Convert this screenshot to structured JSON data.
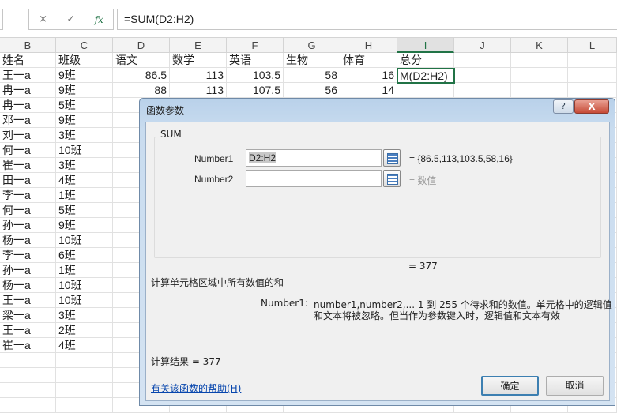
{
  "formula_bar": {
    "cancel_icon": "×",
    "enter_icon": "✓",
    "fx_label": "fx",
    "formula": "=SUM(D2:H2)"
  },
  "columns": [
    "B",
    "C",
    "D",
    "E",
    "F",
    "G",
    "H",
    "I",
    "J",
    "K",
    "L"
  ],
  "headers": [
    "姓名",
    "班级",
    "语文",
    "数学",
    "英语",
    "生物",
    "体育",
    "总分"
  ],
  "rows": [
    {
      "name": "王一a",
      "class": "9班",
      "scores": [
        "86.5",
        "113",
        "103.5",
        "58",
        "16"
      ]
    },
    {
      "name": "冉一a",
      "class": "9班",
      "scores": [
        "88",
        "113",
        "107.5",
        "56",
        "14"
      ]
    },
    {
      "name": "冉一a",
      "class": "5班"
    },
    {
      "name": "邓一a",
      "class": "9班"
    },
    {
      "name": "刘一a",
      "class": "3班"
    },
    {
      "name": "何一a",
      "class": "10班"
    },
    {
      "name": "崔一a",
      "class": "3班"
    },
    {
      "name": "田一a",
      "class": "4班"
    },
    {
      "name": "李一a",
      "class": "1班"
    },
    {
      "name": "何一a",
      "class": "5班"
    },
    {
      "name": "孙一a",
      "class": "9班"
    },
    {
      "name": "杨一a",
      "class": "10班"
    },
    {
      "name": "李一a",
      "class": "6班"
    },
    {
      "name": "孙一a",
      "class": "1班"
    },
    {
      "name": "杨一a",
      "class": "10班"
    },
    {
      "name": "王一a",
      "class": "10班"
    },
    {
      "name": "梁一a",
      "class": "3班"
    },
    {
      "name": "王一a",
      "class": "2班"
    },
    {
      "name": "崔一a",
      "class": "4班"
    }
  ],
  "active_cell_text": "M(D2:H2)",
  "dialog": {
    "title": "函数参数",
    "help": "?",
    "close": "X",
    "function_name": "SUM",
    "arg1_label": "Number1",
    "arg1_value": "D2:H2",
    "arg1_result": "= {86.5,113,103.5,58,16}",
    "arg2_label": "Number2",
    "arg2_value": "",
    "arg2_result": "= 数值",
    "total": "= 377",
    "description": "计算单元格区域中所有数值的和",
    "arg_help_label": "Number1:",
    "arg_help_line1": "number1,number2,...  1 到 255 个待求和的数值。单元格中的逻辑值",
    "arg_help_line2": "和文本将被忽略。但当作为参数键入时，逻辑值和文本有效",
    "result_label": "计算结果 =   377",
    "help_link": "有关该函数的帮助(H)",
    "ok": "确定",
    "cancel": "取消"
  }
}
